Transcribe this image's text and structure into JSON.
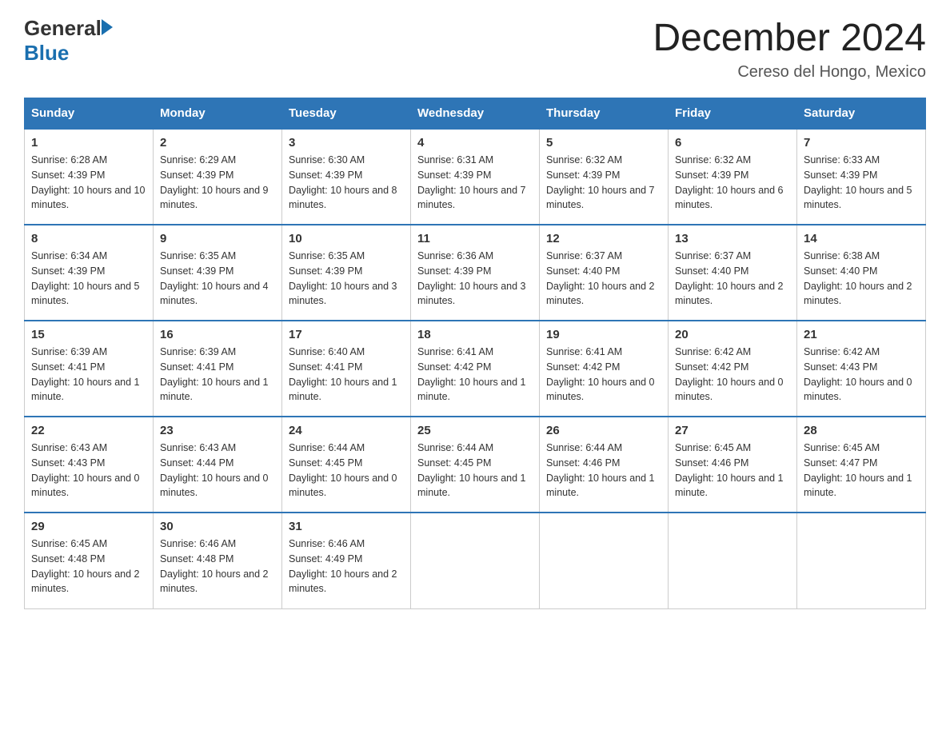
{
  "logo": {
    "text_general": "General",
    "text_blue": "Blue"
  },
  "header": {
    "month_title": "December 2024",
    "location": "Cereso del Hongo, Mexico"
  },
  "days_of_week": [
    "Sunday",
    "Monday",
    "Tuesday",
    "Wednesday",
    "Thursday",
    "Friday",
    "Saturday"
  ],
  "weeks": [
    [
      {
        "day": "1",
        "sunrise": "6:28 AM",
        "sunset": "4:39 PM",
        "daylight": "10 hours and 10 minutes."
      },
      {
        "day": "2",
        "sunrise": "6:29 AM",
        "sunset": "4:39 PM",
        "daylight": "10 hours and 9 minutes."
      },
      {
        "day": "3",
        "sunrise": "6:30 AM",
        "sunset": "4:39 PM",
        "daylight": "10 hours and 8 minutes."
      },
      {
        "day": "4",
        "sunrise": "6:31 AM",
        "sunset": "4:39 PM",
        "daylight": "10 hours and 7 minutes."
      },
      {
        "day": "5",
        "sunrise": "6:32 AM",
        "sunset": "4:39 PM",
        "daylight": "10 hours and 7 minutes."
      },
      {
        "day": "6",
        "sunrise": "6:32 AM",
        "sunset": "4:39 PM",
        "daylight": "10 hours and 6 minutes."
      },
      {
        "day": "7",
        "sunrise": "6:33 AM",
        "sunset": "4:39 PM",
        "daylight": "10 hours and 5 minutes."
      }
    ],
    [
      {
        "day": "8",
        "sunrise": "6:34 AM",
        "sunset": "4:39 PM",
        "daylight": "10 hours and 5 minutes."
      },
      {
        "day": "9",
        "sunrise": "6:35 AM",
        "sunset": "4:39 PM",
        "daylight": "10 hours and 4 minutes."
      },
      {
        "day": "10",
        "sunrise": "6:35 AM",
        "sunset": "4:39 PM",
        "daylight": "10 hours and 3 minutes."
      },
      {
        "day": "11",
        "sunrise": "6:36 AM",
        "sunset": "4:39 PM",
        "daylight": "10 hours and 3 minutes."
      },
      {
        "day": "12",
        "sunrise": "6:37 AM",
        "sunset": "4:40 PM",
        "daylight": "10 hours and 2 minutes."
      },
      {
        "day": "13",
        "sunrise": "6:37 AM",
        "sunset": "4:40 PM",
        "daylight": "10 hours and 2 minutes."
      },
      {
        "day": "14",
        "sunrise": "6:38 AM",
        "sunset": "4:40 PM",
        "daylight": "10 hours and 2 minutes."
      }
    ],
    [
      {
        "day": "15",
        "sunrise": "6:39 AM",
        "sunset": "4:41 PM",
        "daylight": "10 hours and 1 minute."
      },
      {
        "day": "16",
        "sunrise": "6:39 AM",
        "sunset": "4:41 PM",
        "daylight": "10 hours and 1 minute."
      },
      {
        "day": "17",
        "sunrise": "6:40 AM",
        "sunset": "4:41 PM",
        "daylight": "10 hours and 1 minute."
      },
      {
        "day": "18",
        "sunrise": "6:41 AM",
        "sunset": "4:42 PM",
        "daylight": "10 hours and 1 minute."
      },
      {
        "day": "19",
        "sunrise": "6:41 AM",
        "sunset": "4:42 PM",
        "daylight": "10 hours and 0 minutes."
      },
      {
        "day": "20",
        "sunrise": "6:42 AM",
        "sunset": "4:42 PM",
        "daylight": "10 hours and 0 minutes."
      },
      {
        "day": "21",
        "sunrise": "6:42 AM",
        "sunset": "4:43 PM",
        "daylight": "10 hours and 0 minutes."
      }
    ],
    [
      {
        "day": "22",
        "sunrise": "6:43 AM",
        "sunset": "4:43 PM",
        "daylight": "10 hours and 0 minutes."
      },
      {
        "day": "23",
        "sunrise": "6:43 AM",
        "sunset": "4:44 PM",
        "daylight": "10 hours and 0 minutes."
      },
      {
        "day": "24",
        "sunrise": "6:44 AM",
        "sunset": "4:45 PM",
        "daylight": "10 hours and 0 minutes."
      },
      {
        "day": "25",
        "sunrise": "6:44 AM",
        "sunset": "4:45 PM",
        "daylight": "10 hours and 1 minute."
      },
      {
        "day": "26",
        "sunrise": "6:44 AM",
        "sunset": "4:46 PM",
        "daylight": "10 hours and 1 minute."
      },
      {
        "day": "27",
        "sunrise": "6:45 AM",
        "sunset": "4:46 PM",
        "daylight": "10 hours and 1 minute."
      },
      {
        "day": "28",
        "sunrise": "6:45 AM",
        "sunset": "4:47 PM",
        "daylight": "10 hours and 1 minute."
      }
    ],
    [
      {
        "day": "29",
        "sunrise": "6:45 AM",
        "sunset": "4:48 PM",
        "daylight": "10 hours and 2 minutes."
      },
      {
        "day": "30",
        "sunrise": "6:46 AM",
        "sunset": "4:48 PM",
        "daylight": "10 hours and 2 minutes."
      },
      {
        "day": "31",
        "sunrise": "6:46 AM",
        "sunset": "4:49 PM",
        "daylight": "10 hours and 2 minutes."
      },
      null,
      null,
      null,
      null
    ]
  ],
  "labels": {
    "sunrise": "Sunrise:",
    "sunset": "Sunset:",
    "daylight": "Daylight:"
  }
}
